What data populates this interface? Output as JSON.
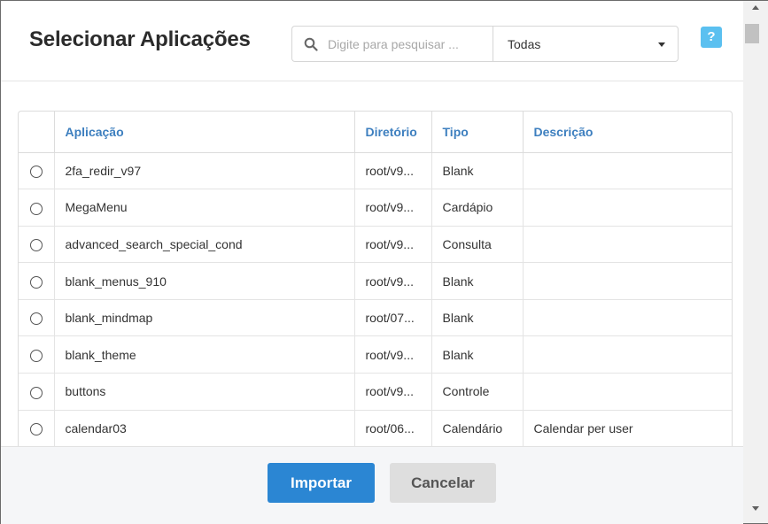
{
  "header": {
    "title": "Selecionar Aplicações",
    "search_placeholder": "Digite para pesquisar ...",
    "filter_selected": "Todas",
    "help_label": "?"
  },
  "table": {
    "columns": [
      "Aplicação",
      "Diretório",
      "Tipo",
      "Descrição"
    ],
    "rows": [
      {
        "app": "2fa_redir_v97",
        "dir": "root/v9...",
        "type": "Blank",
        "desc": ""
      },
      {
        "app": "MegaMenu",
        "dir": "root/v9...",
        "type": "Cardápio",
        "desc": ""
      },
      {
        "app": "advanced_search_special_cond",
        "dir": "root/v9...",
        "type": "Consulta",
        "desc": ""
      },
      {
        "app": "blank_menus_910",
        "dir": "root/v9...",
        "type": "Blank",
        "desc": ""
      },
      {
        "app": "blank_mindmap",
        "dir": "root/07...",
        "type": "Blank",
        "desc": ""
      },
      {
        "app": "blank_theme",
        "dir": "root/v9...",
        "type": "Blank",
        "desc": ""
      },
      {
        "app": "buttons",
        "dir": "root/v9...",
        "type": "Controle",
        "desc": ""
      },
      {
        "app": "calendar03",
        "dir": "root/06...",
        "type": "Calendário",
        "desc": "Calendar per user"
      }
    ]
  },
  "footer": {
    "import_label": "Importar",
    "cancel_label": "Cancelar"
  },
  "icons": {
    "search": "search-icon",
    "caret": "chevron-down-icon",
    "help": "help-icon"
  },
  "colors": {
    "accent": "#2b86d3",
    "header_text": "#3d7fbf",
    "help": "#5bc0f0"
  }
}
